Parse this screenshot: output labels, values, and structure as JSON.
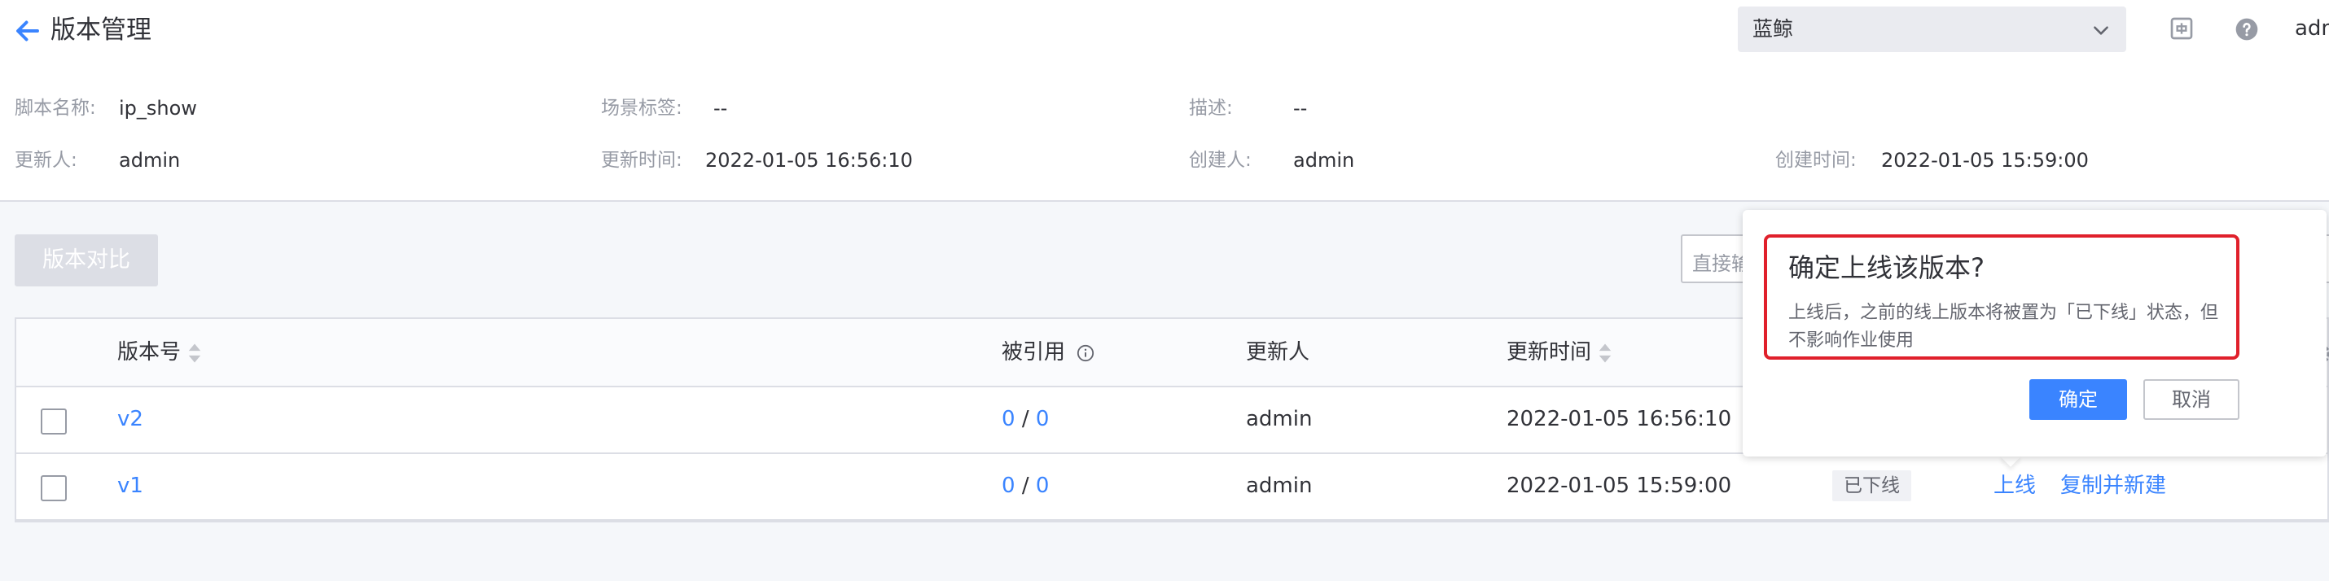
{
  "header": {
    "title": "版本管理",
    "back_icon": "arrow-left-icon",
    "business_select": "蓝鲸",
    "user": "adm"
  },
  "info": {
    "script_name_label": "脚本名称:",
    "script_name": "ip_show",
    "scene_tag_label": "场景标签:",
    "scene_tag": "--",
    "desc_label": "描述:",
    "desc": "--",
    "updater_label": "更新人:",
    "updater": "admin",
    "update_time_label": "更新时间:",
    "update_time": "2022-01-05 16:56:10",
    "creator_label": "创建人:",
    "creator": "admin",
    "create_time_label": "创建时间:",
    "create_time": "2022-01-05 15:59:00"
  },
  "toolbar": {
    "compare_label": "版本对比",
    "search_placeholder": "直接输"
  },
  "table": {
    "columns": [
      "版本号",
      "被引用",
      "更新人",
      "更新时间"
    ],
    "rows": [
      {
        "version": "v2",
        "ref_a": "0",
        "ref_sep": "/",
        "ref_b": "0",
        "updater": "admin",
        "time": "2022-01-05 16:56:10"
      },
      {
        "version": "v1",
        "ref_a": "0",
        "ref_sep": "/",
        "ref_b": "0",
        "updater": "admin",
        "time": "2022-01-05 15:59:00",
        "status": "已下线",
        "action_online": "上线",
        "action_copy": "复制并新建"
      }
    ]
  },
  "popconfirm": {
    "title": "确定上线该版本?",
    "content": "上线后，之前的线上版本将被置为「已下线」状态，但不影响作业使用",
    "ok_label": "确定",
    "cancel_label": "取消"
  },
  "colors": {
    "accent": "#3a84ff",
    "highlight": "#e0202b"
  }
}
